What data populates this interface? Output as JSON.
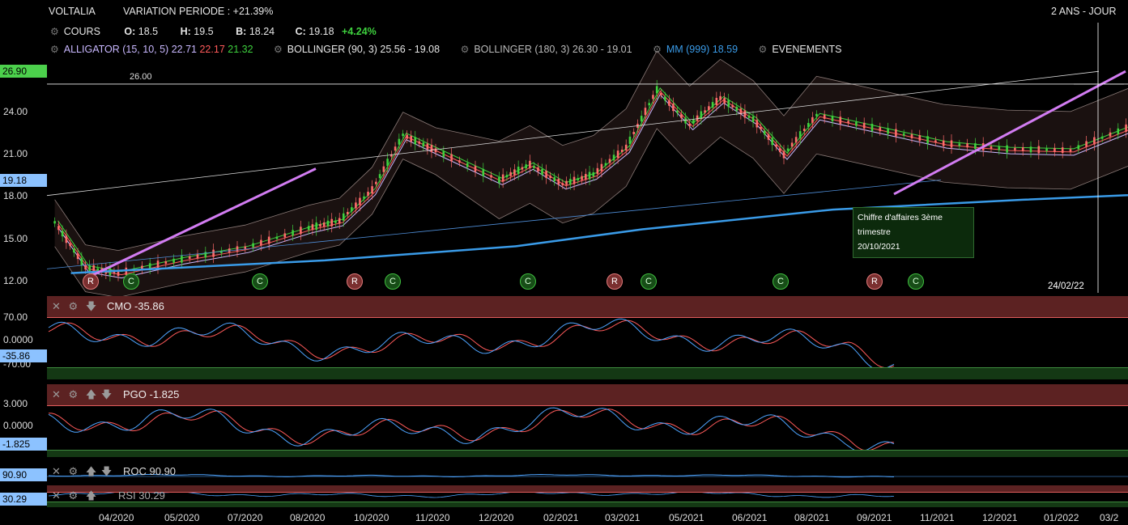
{
  "header": {
    "symbol": "VOLTALIA",
    "variation": "VARIATION PERIODE : +21.39%",
    "period": "2 ANS - JOUR"
  },
  "ohlc": {
    "label": "COURS",
    "o_key": "O:",
    "o": "18.5",
    "h_key": "H:",
    "h": "19.5",
    "b_key": "B:",
    "b": "18.24",
    "c_key": "C:",
    "c": "19.18",
    "change": "+4.24%"
  },
  "indicators": {
    "alligator_label": "ALLIGATOR (15, 10, 5)",
    "alligator_v1": "22.71",
    "alligator_v2": "22.17",
    "alligator_v3": "21.32",
    "boll1": "BOLLINGER (90, 3) 25.56 - 19.08",
    "boll2": "BOLLINGER (180, 3) 26.30 - 19.01",
    "mm": "MM (999) 18.59",
    "events": "EVENEMENTS"
  },
  "colors": {
    "alligator_v1": "#c9b8ff",
    "alligator_v2": "#ff5a5a",
    "alligator_v3": "#3ed13e",
    "mm": "#3a9be8",
    "change": "#3ed13e",
    "trend_line": "#d27cf2"
  },
  "price_tags": {
    "top": "26.90",
    "current": "19.18"
  },
  "hline_label": "26.00",
  "note": {
    "line1": "Chiffre d'affaires 3ème",
    "line2": "trimestre",
    "date": "20/10/2021"
  },
  "crosshair_date": "24/02/22",
  "events": [
    "R",
    "C",
    "C",
    "R",
    "C",
    "C",
    "R",
    "C",
    "C",
    "R",
    "C"
  ],
  "panels": {
    "cmo": {
      "label": "CMO -35.86",
      "top_tick": "70.00",
      "mid_tick": "0.0000",
      "bot_tick": "-70.00",
      "value": "-35.86"
    },
    "pgo": {
      "label": "PGO -1.825",
      "top_tick": "3.000",
      "mid_tick": "0.0000",
      "value": "-1.825"
    },
    "roc": {
      "label": "ROC 90.90",
      "value": "90.90"
    },
    "rsi": {
      "label": "RSI 30.29",
      "value": "30.29"
    }
  },
  "chart_data": {
    "type": "candlestick",
    "ylim": [
      11.2,
      27.6
    ],
    "yticks": [
      "27.00",
      "24.00",
      "21.00",
      "18.00",
      "15.00",
      "12.00"
    ],
    "xticks": [
      "04/2020",
      "05/2020",
      "07/2020",
      "08/2020",
      "10/2020",
      "11/2020",
      "12/2020",
      "02/2021",
      "03/2021",
      "05/2021",
      "06/2021",
      "08/2021",
      "09/2021",
      "11/2021",
      "12/2021",
      "01/2022",
      "03/2"
    ],
    "approx_close": [
      {
        "x": "03/2020",
        "y": 16.2
      },
      {
        "x": "03/2020",
        "y": 13.0
      },
      {
        "x": "04/2020",
        "y": 12.6
      },
      {
        "x": "05/2020",
        "y": 13.6
      },
      {
        "x": "06/2020",
        "y": 14.4
      },
      {
        "x": "07/2020",
        "y": 15.8
      },
      {
        "x": "07/2020",
        "y": 16.3
      },
      {
        "x": "08/2020",
        "y": 18.5
      },
      {
        "x": "08/2020",
        "y": 22.4
      },
      {
        "x": "09/2020",
        "y": 21.3
      },
      {
        "x": "10/2020",
        "y": 19.2
      },
      {
        "x": "10/2020",
        "y": 20.3
      },
      {
        "x": "11/2020",
        "y": 18.9
      },
      {
        "x": "11/2020",
        "y": 19.6
      },
      {
        "x": "12/2020",
        "y": 21.5
      },
      {
        "x": "12/2020",
        "y": 25.6
      },
      {
        "x": "01/2021",
        "y": 23.1
      },
      {
        "x": "01/2021",
        "y": 25.0
      },
      {
        "x": "02/2021",
        "y": 23.5
      },
      {
        "x": "02/2021",
        "y": 21.0
      },
      {
        "x": "03/2021",
        "y": 23.8
      },
      {
        "x": "04/2021",
        "y": 22.8
      },
      {
        "x": "05/2021",
        "y": 21.8
      },
      {
        "x": "06/2021",
        "y": 21.4
      },
      {
        "x": "07/2021",
        "y": 21.3
      },
      {
        "x": "08/2021",
        "y": 23.1
      },
      {
        "x": "08/2021",
        "y": 23.6
      },
      {
        "x": "09/2021",
        "y": 22.4
      },
      {
        "x": "09/2021",
        "y": 21.0
      },
      {
        "x": "10/2021",
        "y": 18.6
      },
      {
        "x": "10/2021",
        "y": 19.18
      }
    ],
    "mm_999": [
      {
        "x": "03/2020",
        "y": 12.6
      },
      {
        "x": "07/2020",
        "y": 13.5
      },
      {
        "x": "10/2020",
        "y": 14.5
      },
      {
        "x": "12/2020",
        "y": 15.7
      },
      {
        "x": "03/2021",
        "y": 17.1
      },
      {
        "x": "06/2021",
        "y": 17.8
      },
      {
        "x": "10/2021",
        "y": 18.59
      }
    ],
    "trend_line": [
      {
        "x": "04/2020",
        "y": 12.2
      },
      {
        "x": "08/2020",
        "y": 20.0
      },
      {
        "x": "10/2021",
        "y": 18.2
      },
      {
        "x": "03/2022",
        "y": 26.9
      }
    ]
  }
}
